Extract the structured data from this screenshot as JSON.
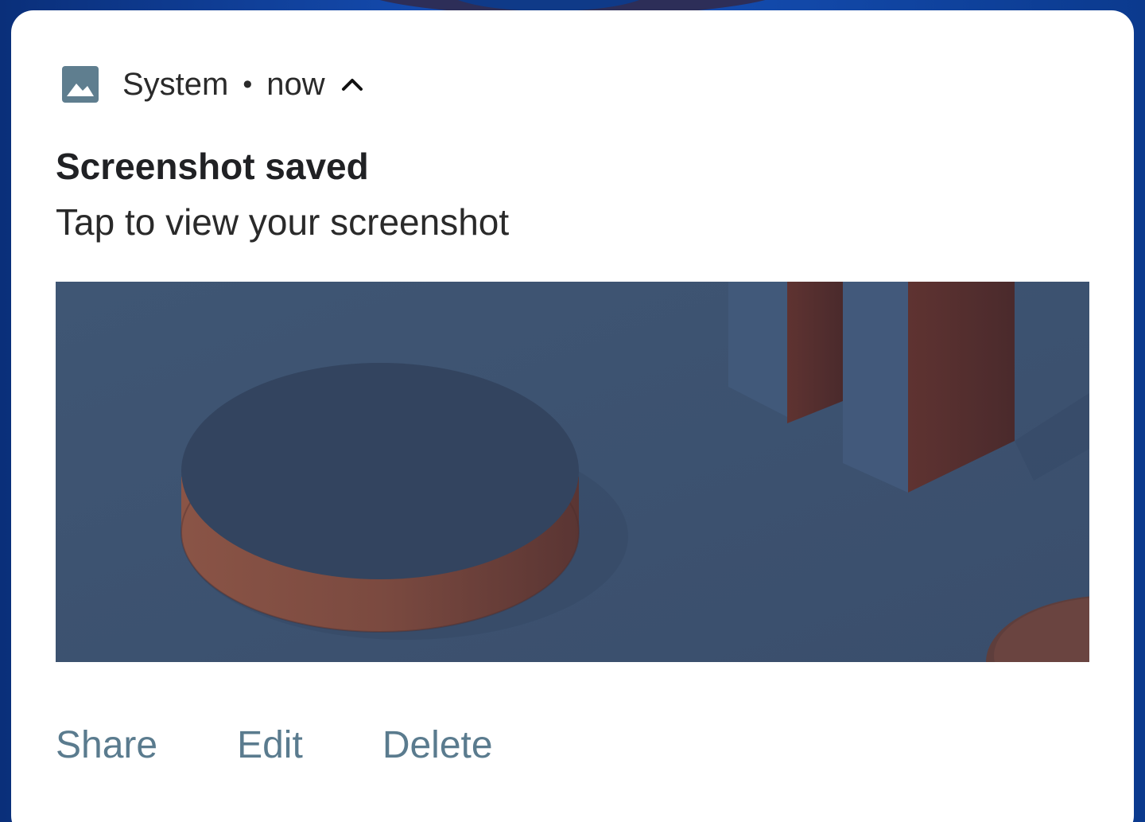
{
  "notification": {
    "app_icon": "image-icon",
    "app_name": "System",
    "separator": "•",
    "time": "now",
    "expand_icon": "chevron-up-icon",
    "title": "Screenshot saved",
    "subtitle": "Tap to view your screenshot",
    "preview_image": "screenshot-thumbnail"
  },
  "actions": [
    {
      "label": "Share"
    },
    {
      "label": "Edit"
    },
    {
      "label": "Delete"
    }
  ],
  "colors": {
    "card_background": "#ffffff",
    "action_text": "#5a7b8e",
    "icon_tint": "#5f7e8f",
    "preview_background": "#3d516f",
    "preview_accent": "#7a4a42"
  }
}
